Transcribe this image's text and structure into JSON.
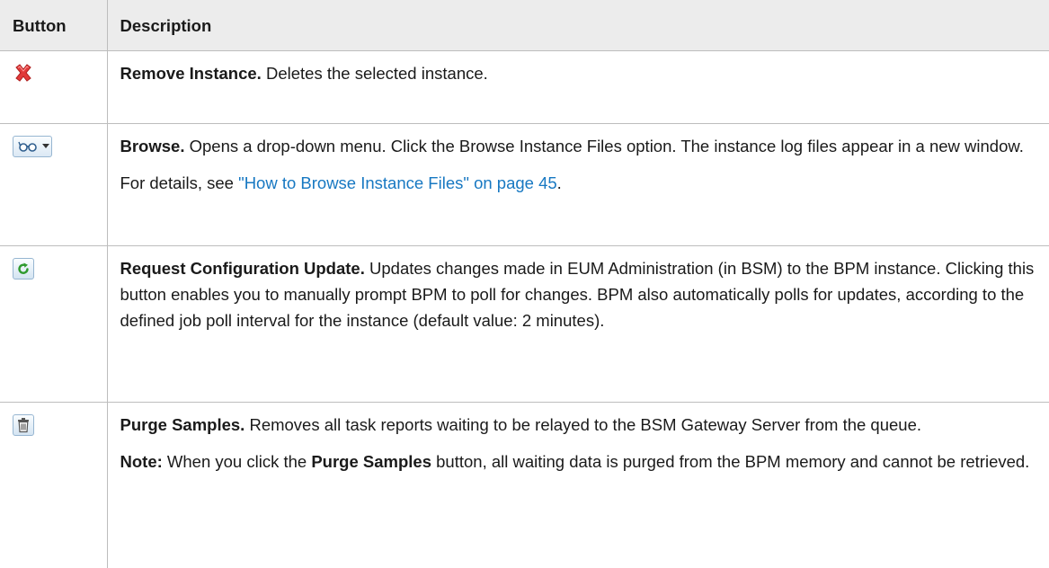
{
  "table": {
    "header": {
      "button": "Button",
      "description": "Description"
    },
    "rows": [
      {
        "icon": "remove-icon",
        "title": "Remove Instance.",
        "text": " Deletes the selected instance."
      },
      {
        "icon": "browse-icon",
        "title": "Browse.",
        "text": " Opens a drop-down menu. Click the Browse Instance Files option. The instance log files appear in a new window.",
        "detail_prefix": "For details, see ",
        "link": "\"How to Browse Instance Files\" on page 45",
        "detail_suffix": "."
      },
      {
        "icon": "refresh-icon",
        "title": "Request Configuration Update.",
        "text": " Updates changes made in EUM Administration (in BSM) to the BPM instance. Clicking this button enables you to manually prompt BPM to poll for changes. BPM also automatically polls for updates, according to the defined job poll interval for the instance (default value: 2 minutes)."
      },
      {
        "icon": "trash-icon",
        "title": "Purge Samples.",
        "text": " Removes all task reports waiting to be relayed to the BSM Gateway Server from the queue.",
        "note_label": "Note:",
        "note_pre": " When you click the ",
        "note_bold": "Purge Samples",
        "note_post": " button, all waiting data is purged from the BPM memory and cannot be retrieved."
      }
    ]
  },
  "colors": {
    "link": "#1778c2",
    "header_bg": "#ececec",
    "border": "#bdbdbd"
  }
}
